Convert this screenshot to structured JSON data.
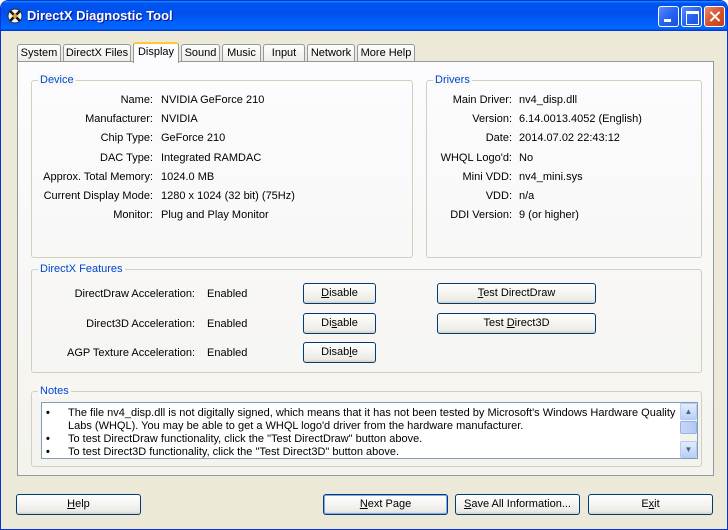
{
  "window": {
    "title": "DirectX Diagnostic Tool"
  },
  "tabs": [
    {
      "label": "System"
    },
    {
      "label": "DirectX Files"
    },
    {
      "label": "Display",
      "active": true
    },
    {
      "label": "Sound"
    },
    {
      "label": "Music"
    },
    {
      "label": "Input"
    },
    {
      "label": "Network"
    },
    {
      "label": "More Help"
    }
  ],
  "device": {
    "title": "Device",
    "rows": [
      {
        "label": "Name:",
        "value": "NVIDIA GeForce 210"
      },
      {
        "label": "Manufacturer:",
        "value": "NVIDIA"
      },
      {
        "label": "Chip Type:",
        "value": "GeForce 210"
      },
      {
        "label": "DAC Type:",
        "value": "Integrated RAMDAC"
      },
      {
        "label": "Approx. Total Memory:",
        "value": "1024.0 MB"
      },
      {
        "label": "Current Display Mode:",
        "value": "1280 x 1024 (32 bit) (75Hz)"
      },
      {
        "label": "Monitor:",
        "value": "Plug and Play Monitor"
      }
    ]
  },
  "drivers": {
    "title": "Drivers",
    "rows": [
      {
        "label": "Main Driver:",
        "value": "nv4_disp.dll"
      },
      {
        "label": "Version:",
        "value": "6.14.0013.4052 (English)"
      },
      {
        "label": "Date:",
        "value": "2014.07.02 22:43:12"
      },
      {
        "label": "WHQL Logo'd:",
        "value": "No"
      },
      {
        "label": "Mini VDD:",
        "value": "nv4_mini.sys"
      },
      {
        "label": "VDD:",
        "value": "n/a"
      },
      {
        "label": "DDI Version:",
        "value": "9 (or higher)"
      }
    ]
  },
  "features": {
    "title": "DirectX Features",
    "rows": [
      {
        "label": "DirectDraw Acceleration:",
        "value": "Enabled",
        "button_prefix": "",
        "button_key": "D",
        "button_rest": "isable",
        "test_prefix": "",
        "test_key": "T",
        "test_rest": "est DirectDraw"
      },
      {
        "label": "Direct3D Acceleration:",
        "value": "Enabled",
        "button_prefix": "Di",
        "button_key": "s",
        "button_rest": "able",
        "test_prefix": "Test ",
        "test_key": "D",
        "test_rest": "irect3D"
      },
      {
        "label": "AGP Texture Acceleration:",
        "value": "Enabled",
        "button_prefix": "Disab",
        "button_key": "l",
        "button_rest": "e"
      }
    ]
  },
  "notes": {
    "title": "Notes",
    "lines": [
      {
        "bullet": "•",
        "text": "The file nv4_disp.dll is not digitally signed, which means that it has not been tested by Microsoft's Windows Hardware Quality Labs (WHQL).  You may be able to get a WHQL logo'd driver from the hardware manufacturer."
      },
      {
        "bullet": "•",
        "text": "To test DirectDraw functionality, click the \"Test DirectDraw\" button above."
      },
      {
        "bullet": "•",
        "text": "To test Direct3D functionality, click the \"Test Direct3D\" button above."
      }
    ]
  },
  "bottom_buttons": {
    "help_key": "H",
    "help_rest": "elp",
    "next_key": "N",
    "next_rest": "ext Page",
    "save_key": "S",
    "save_rest": "ave All Information...",
    "exit_prefix": "E",
    "exit_key": "x",
    "exit_rest": "it"
  },
  "colors": {
    "accent": "#0046d5",
    "titlebar": "#0053ee",
    "window_bg": "#ece9d8"
  }
}
